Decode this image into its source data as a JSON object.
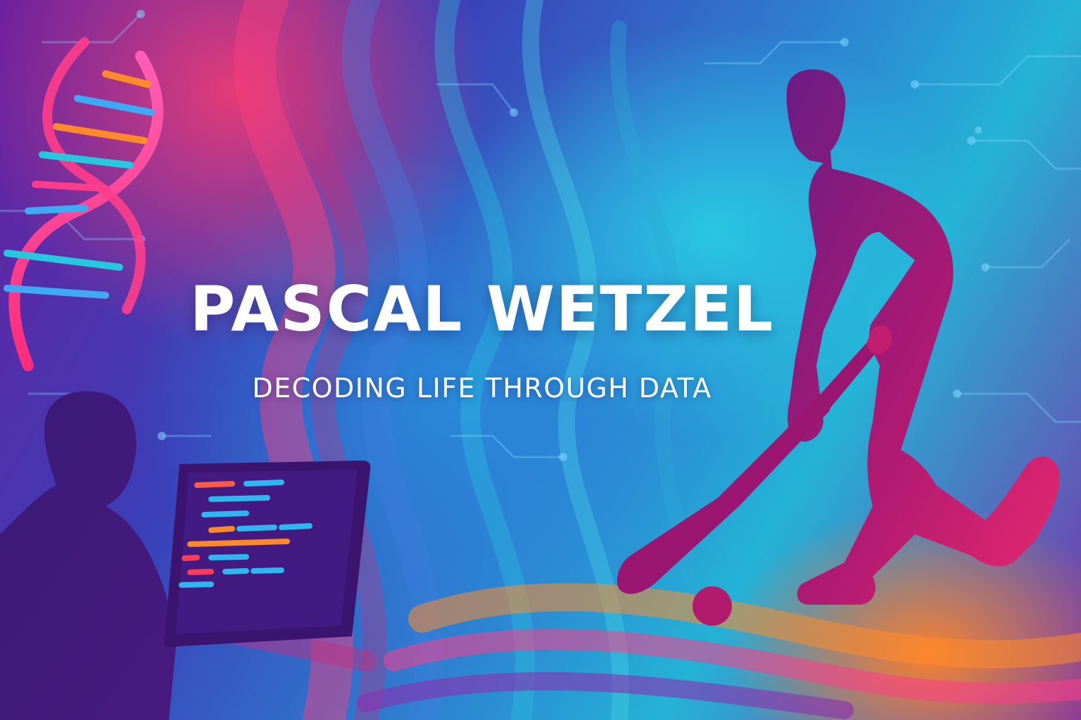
{
  "hero": {
    "title": "PASCAL WETZEL",
    "subtitle": "DECODING LIFE THROUGH DATA"
  },
  "illustrations": {
    "dna": "dna-helix-icon",
    "coder": "coder-silhouette-icon",
    "laptop": "laptop-icon",
    "player": "field-hockey-player-icon",
    "ball": "hockey-ball-icon"
  },
  "colors": {
    "text": "#ffffff",
    "silhouette": "#5a1c86",
    "player_fill": "#a3176e",
    "pink": "#ff3d8b",
    "cyan": "#27c7e0",
    "orange": "#ff8a2a",
    "purple": "#6a1f9e"
  }
}
